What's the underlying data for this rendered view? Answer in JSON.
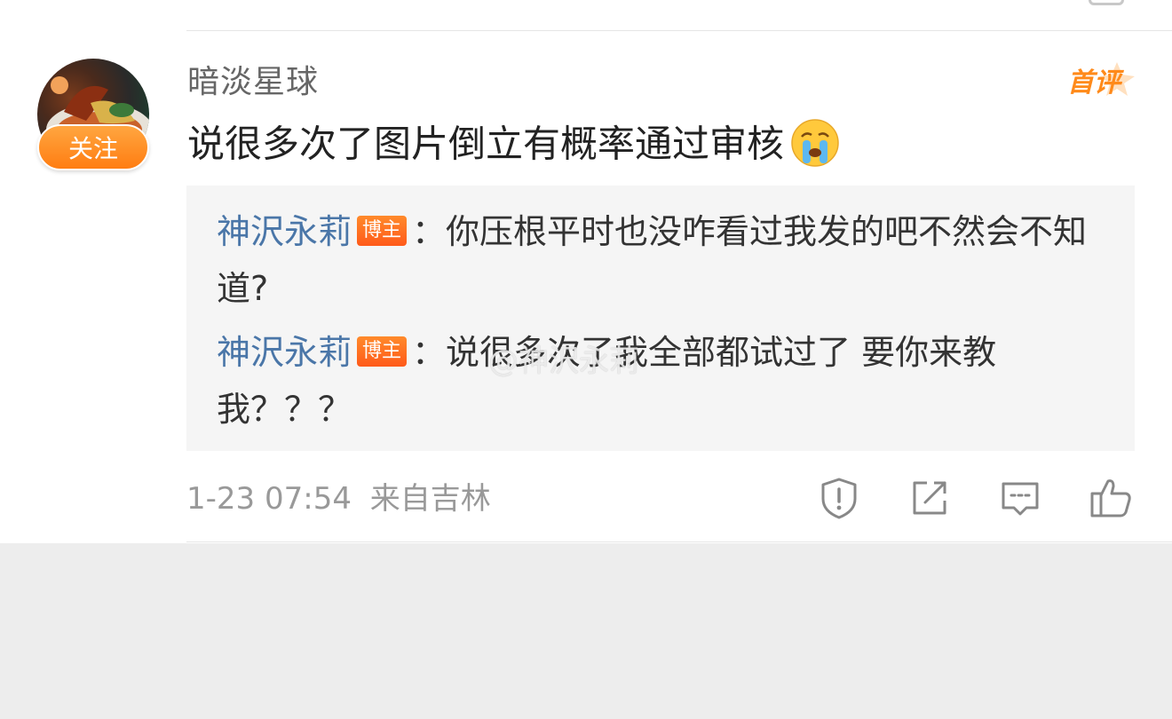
{
  "comment": {
    "username": "暗淡星球",
    "follow_label": "关注",
    "first_badge": "首评",
    "text": "说很多次了图片倒立有概率通过审核",
    "emoji": "crying-face-icon"
  },
  "replies": [
    {
      "author": "神沢永莉",
      "tag": "博主",
      "text": "：你压根平时也没咋看过我发的吧不然会不知道?"
    },
    {
      "author": "神沢永莉",
      "tag": "博主",
      "text": "：说很多次了我全部都试过了 要你来教我？？？"
    }
  ],
  "watermark": "@神沢永莉",
  "meta": {
    "time": "1-23 07:54",
    "source": "来自吉林"
  },
  "actions": [
    "report-icon",
    "share-icon",
    "reply-icon",
    "like-icon"
  ],
  "colors": {
    "follow_button": "#ff8a1a",
    "author_link": "#4a76a8",
    "blogger_tag": "#ff6a1a",
    "reply_background": "#f5f5f5"
  }
}
